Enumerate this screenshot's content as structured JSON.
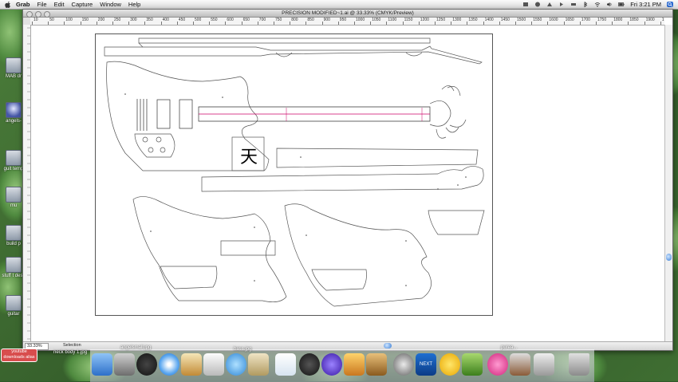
{
  "menubar": {
    "app_name": "Grab",
    "menus": [
      "File",
      "Edit",
      "Capture",
      "Window",
      "Help"
    ],
    "clock": "Fri 3:21 PM"
  },
  "desktop_icons": [
    {
      "label": "MAB dr"
    },
    {
      "label": "angels-"
    },
    {
      "label": "guit temp"
    },
    {
      "label": "mu"
    },
    {
      "label": "build p"
    },
    {
      "label": "stuff t desk"
    },
    {
      "label": "guitar"
    }
  ],
  "window": {
    "title": "PRECISION MODIFIED~1.ai @ 33.33% (CMYK/Preview)",
    "ruler_labels": [
      "10",
      "50",
      "100",
      "150",
      "200",
      "250",
      "300",
      "350",
      "400",
      "450",
      "500",
      "550",
      "600",
      "650",
      "700",
      "750",
      "800",
      "850",
      "900",
      "950",
      "1000",
      "1050",
      "1100",
      "1150",
      "1200",
      "1250",
      "1300",
      "1350",
      "1400",
      "1450",
      "1500",
      "1550",
      "1600",
      "1650",
      "1700",
      "1750",
      "1800",
      "1850",
      "1900",
      "1950"
    ],
    "zoom": "33.33%",
    "tool": "Selection",
    "glyph": "天"
  },
  "dock": {
    "labels": {
      "neck": "neck body 1.jpg",
      "angels": "angelsmall.jpg",
      "bass": "bass.jpg",
      "pure": "purea..."
    },
    "youtube": "youtube downloads alias",
    "next_label": "NEXT",
    "colors": {
      "accent": "#3c7fd6"
    }
  }
}
